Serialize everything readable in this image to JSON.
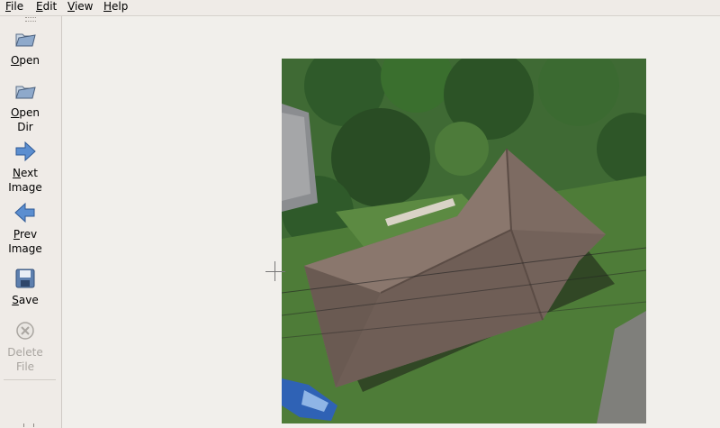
{
  "menu": {
    "file": {
      "accel": "F",
      "rest": "ile"
    },
    "edit": {
      "accel": "E",
      "rest": "dit"
    },
    "view": {
      "accel": "V",
      "rest": "iew"
    },
    "help": {
      "accel": "H",
      "rest": "elp"
    }
  },
  "toolbar": {
    "open": {
      "accel": "O",
      "rest": "pen",
      "icon": "folder-open-icon"
    },
    "open_dir": {
      "line1_accel": "O",
      "line1_rest": "pen",
      "line2": "Dir",
      "icon": "folder-open-icon"
    },
    "next": {
      "line1_accel": "N",
      "line1_rest": "ext",
      "line2": "Image",
      "icon": "arrow-right-icon"
    },
    "prev": {
      "line1_accel": "P",
      "line1_rest": "rev",
      "line2": "Image",
      "icon": "arrow-left-icon"
    },
    "save": {
      "accel": "S",
      "rest": "ave",
      "icon": "floppy-disk-icon"
    },
    "delete": {
      "line1": "Delete",
      "line2": "File",
      "icon": "delete-icon",
      "enabled": false
    }
  },
  "colors": {
    "window_bg": "#efebe7",
    "roof": "#7d6b62",
    "vegetation": "#4f7a3c",
    "icon_blue": "#4d7ebd"
  }
}
